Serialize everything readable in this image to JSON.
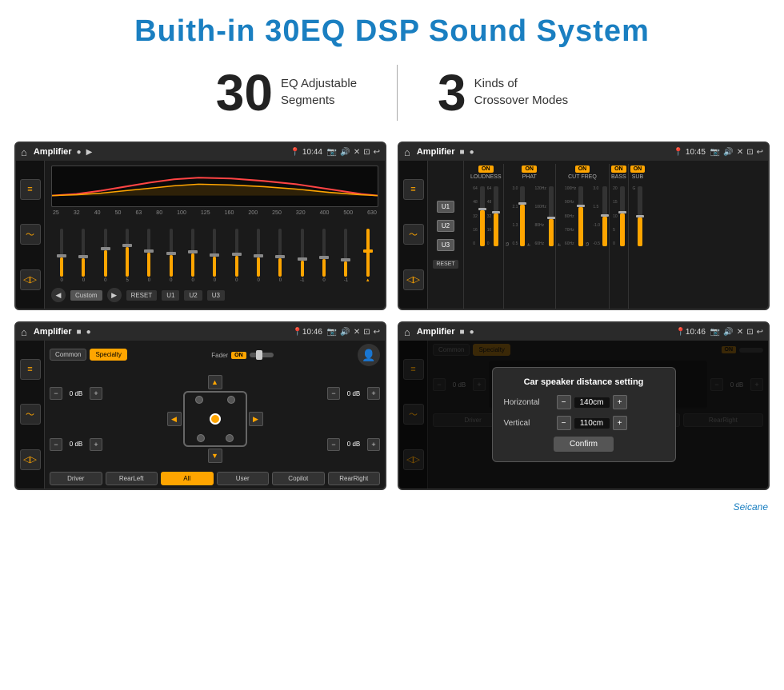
{
  "page": {
    "title": "Buith-in 30EQ DSP Sound System",
    "stat1_number": "30",
    "stat1_label_line1": "EQ Adjustable",
    "stat1_label_line2": "Segments",
    "stat2_number": "3",
    "stat2_label_line1": "Kinds of",
    "stat2_label_line2": "Crossover Modes"
  },
  "screen1": {
    "title": "Amplifier",
    "time": "10:44",
    "freq_labels": [
      "25",
      "32",
      "40",
      "50",
      "63",
      "80",
      "100",
      "125",
      "160",
      "200",
      "250",
      "320",
      "400",
      "500",
      "630"
    ],
    "bottom_buttons": [
      "Custom",
      "RESET",
      "U1",
      "U2",
      "U3"
    ],
    "slider_values": [
      "0",
      "0",
      "0",
      "5",
      "0",
      "0",
      "0",
      "0",
      "0",
      "0",
      "0",
      "-1",
      "0",
      "-1"
    ]
  },
  "screen2": {
    "title": "Amplifier",
    "time": "10:45",
    "channels": [
      {
        "u": "U1",
        "on_label": "ON",
        "name": "LOUDNESS"
      },
      {
        "u": "U2",
        "on_label": "ON",
        "name": "PHAT"
      },
      {
        "u": "U3",
        "on_label": "ON",
        "name": "CUT FREQ"
      },
      {
        "on_label": "ON",
        "name": "BASS"
      },
      {
        "on_label": "ON",
        "name": "SUB"
      }
    ],
    "reset_label": "RESET"
  },
  "screen3": {
    "title": "Amplifier",
    "time": "10:46",
    "tabs": [
      "Common",
      "Specialty"
    ],
    "active_tab": "Specialty",
    "fader_label": "Fader",
    "on_label": "ON",
    "db_values": [
      "0 dB",
      "0 dB",
      "0 dB",
      "0 dB"
    ],
    "bottom_buttons": [
      "Driver",
      "RearLeft",
      "All",
      "User",
      "Copilot",
      "RearRight"
    ]
  },
  "screen4": {
    "title": "Amplifier",
    "time": "10:46",
    "tabs": [
      "Common",
      "Specialty"
    ],
    "active_tab": "Specialty",
    "on_label": "ON",
    "dialog": {
      "title": "Car speaker distance setting",
      "horizontal_label": "Horizontal",
      "horizontal_value": "140cm",
      "vertical_label": "Vertical",
      "vertical_value": "110cm",
      "db_label1": "0 dB",
      "db_label2": "0 dB",
      "confirm_label": "Confirm"
    },
    "bottom_buttons": [
      "Driver",
      "RearLeft",
      "Copilot",
      "RearRight"
    ]
  },
  "watermark": "Seicane"
}
